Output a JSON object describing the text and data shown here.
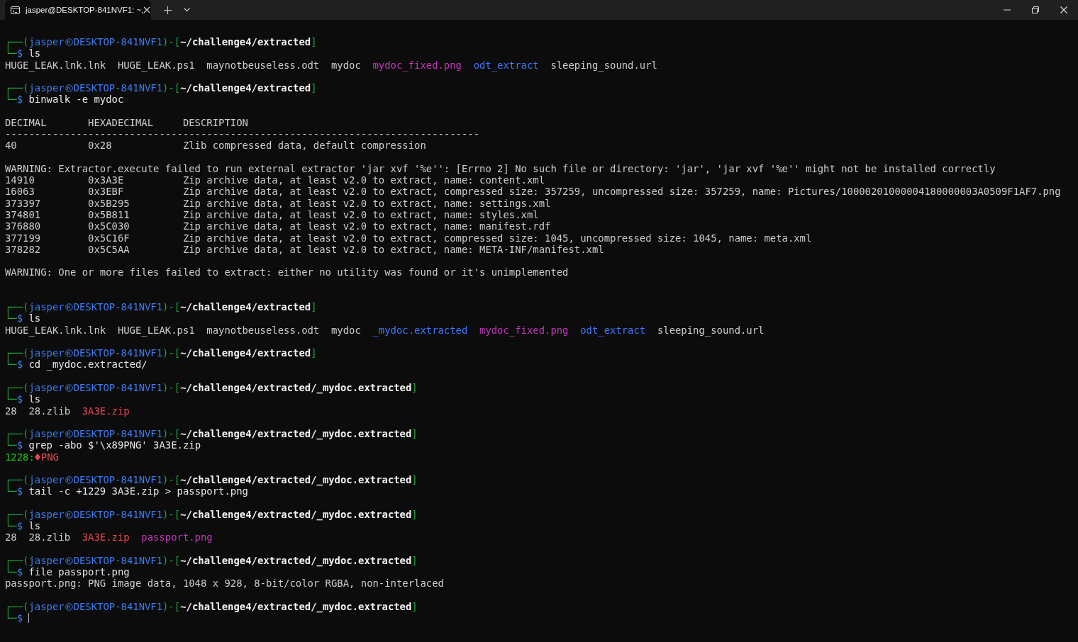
{
  "tabs": [
    {
      "title": "jasper@DESKTOP-841NVF1: ~,",
      "selected": true
    }
  ],
  "terminal": {
    "lines": [
      {
        "kind": "prompt",
        "open": "┌──(",
        "user": "jasper",
        "host": "DESKTOP-841NVF1",
        "mid": ")-[",
        "path": "~/challenge4/extracted",
        "close": "]",
        "corner": "└─",
        "sigil": "$",
        "command": "ls"
      },
      {
        "kind": "listing",
        "items": [
          {
            "text": "HUGE_LEAK.lnk.lnk",
            "color": "#cccccc"
          },
          {
            "text": "HUGE_LEAK.ps1",
            "color": "#cccccc"
          },
          {
            "text": "maynotbeuseless.odt",
            "color": "#cccccc"
          },
          {
            "text": "mydoc",
            "color": "#cccccc"
          },
          {
            "text": "mydoc_fixed.png",
            "color": "#c535bd"
          },
          {
            "text": "odt_extract",
            "color": "#3b78ff"
          },
          {
            "text": "sleeping_sound.url",
            "color": "#cccccc"
          }
        ]
      },
      {
        "kind": "blank"
      },
      {
        "kind": "prompt",
        "open": "┌──(",
        "user": "jasper",
        "host": "DESKTOP-841NVF1",
        "mid": ")-[",
        "path": "~/challenge4/extracted",
        "close": "]",
        "corner": "└─",
        "sigil": "$",
        "command": "binwalk -e mydoc"
      },
      {
        "kind": "blank"
      },
      {
        "kind": "output",
        "segments": [
          {
            "text": "DECIMAL       HEXADECIMAL     DESCRIPTION"
          }
        ]
      },
      {
        "kind": "output",
        "segments": [
          {
            "text": "--------------------------------------------------------------------------------"
          }
        ]
      },
      {
        "kind": "output",
        "segments": [
          {
            "text": "40            0x28            Zlib compressed data, default compression"
          }
        ]
      },
      {
        "kind": "blank"
      },
      {
        "kind": "output",
        "segments": [
          {
            "text": "WARNING: Extractor.execute failed to run external extractor 'jar xvf '%e'': [Errno 2] No such file or directory: 'jar', 'jar xvf '%e'' might not be installed correctly"
          }
        ]
      },
      {
        "kind": "output",
        "segments": [
          {
            "text": "14910         0x3A3E          Zip archive data, at least v2.0 to extract, name: content.xml"
          }
        ]
      },
      {
        "kind": "output",
        "segments": [
          {
            "text": "16063         0x3EBF          Zip archive data, at least v2.0 to extract, compressed size: 357259, uncompressed size: 357259, name: Pictures/10000201000004180000003A0509F1AF7.png"
          }
        ]
      },
      {
        "kind": "output",
        "segments": [
          {
            "text": "373397        0x5B295         Zip archive data, at least v2.0 to extract, name: settings.xml"
          }
        ]
      },
      {
        "kind": "output",
        "segments": [
          {
            "text": "374801        0x5B811         Zip archive data, at least v2.0 to extract, name: styles.xml"
          }
        ]
      },
      {
        "kind": "output",
        "segments": [
          {
            "text": "376880        0x5C030         Zip archive data, at least v2.0 to extract, name: manifest.rdf"
          }
        ]
      },
      {
        "kind": "output",
        "segments": [
          {
            "text": "377199        0x5C16F         Zip archive data, at least v2.0 to extract, compressed size: 1045, uncompressed size: 1045, name: meta.xml"
          }
        ]
      },
      {
        "kind": "output",
        "segments": [
          {
            "text": "378282        0x5C5AA         Zip archive data, at least v2.0 to extract, name: META-INF/manifest.xml"
          }
        ]
      },
      {
        "kind": "blank"
      },
      {
        "kind": "output",
        "segments": [
          {
            "text": "WARNING: One or more files failed to extract: either no utility was found or it's unimplemented"
          }
        ]
      },
      {
        "kind": "blank"
      },
      {
        "kind": "blank"
      },
      {
        "kind": "prompt",
        "open": "┌──(",
        "user": "jasper",
        "host": "DESKTOP-841NVF1",
        "mid": ")-[",
        "path": "~/challenge4/extracted",
        "close": "]",
        "corner": "└─",
        "sigil": "$",
        "command": "ls"
      },
      {
        "kind": "listing",
        "items": [
          {
            "text": "HUGE_LEAK.lnk.lnk",
            "color": "#cccccc"
          },
          {
            "text": "HUGE_LEAK.ps1",
            "color": "#cccccc"
          },
          {
            "text": "maynotbeuseless.odt",
            "color": "#cccccc"
          },
          {
            "text": "mydoc",
            "color": "#cccccc"
          },
          {
            "text": "_mydoc.extracted",
            "color": "#3b78ff"
          },
          {
            "text": "mydoc_fixed.png",
            "color": "#c535bd"
          },
          {
            "text": "odt_extract",
            "color": "#3b78ff"
          },
          {
            "text": "sleeping_sound.url",
            "color": "#cccccc"
          }
        ]
      },
      {
        "kind": "blank"
      },
      {
        "kind": "prompt",
        "open": "┌──(",
        "user": "jasper",
        "host": "DESKTOP-841NVF1",
        "mid": ")-[",
        "path": "~/challenge4/extracted",
        "close": "]",
        "corner": "└─",
        "sigil": "$",
        "command": "cd _mydoc.extracted/"
      },
      {
        "kind": "blank"
      },
      {
        "kind": "prompt",
        "open": "┌──(",
        "user": "jasper",
        "host": "DESKTOP-841NVF1",
        "mid": ")-[",
        "path": "~/challenge4/extracted/_mydoc.extracted",
        "close": "]",
        "corner": "└─",
        "sigil": "$",
        "command": "ls"
      },
      {
        "kind": "listing",
        "items": [
          {
            "text": "28",
            "color": "#cccccc"
          },
          {
            "text": "28.zlib",
            "color": "#cccccc"
          },
          {
            "text": "3A3E.zip",
            "color": "#e74856"
          }
        ]
      },
      {
        "kind": "blank"
      },
      {
        "kind": "prompt",
        "open": "┌──(",
        "user": "jasper",
        "host": "DESKTOP-841NVF1",
        "mid": ")-[",
        "path": "~/challenge4/extracted/_mydoc.extracted",
        "close": "]",
        "corner": "└─",
        "sigil": "$",
        "command": "grep -abo $'\\x89PNG' 3A3E.zip"
      },
      {
        "kind": "output",
        "segments": [
          {
            "text": "1228:",
            "color": "#16c60c"
          },
          {
            "kind": "glyph",
            "color": "#e74856"
          },
          {
            "text": "PNG",
            "color": "#e74856"
          }
        ]
      },
      {
        "kind": "blank"
      },
      {
        "kind": "prompt",
        "open": "┌──(",
        "user": "jasper",
        "host": "DESKTOP-841NVF1",
        "mid": ")-[",
        "path": "~/challenge4/extracted/_mydoc.extracted",
        "close": "]",
        "corner": "└─",
        "sigil": "$",
        "command": "tail -c +1229 3A3E.zip > passport.png"
      },
      {
        "kind": "blank"
      },
      {
        "kind": "prompt",
        "open": "┌──(",
        "user": "jasper",
        "host": "DESKTOP-841NVF1",
        "mid": ")-[",
        "path": "~/challenge4/extracted/_mydoc.extracted",
        "close": "]",
        "corner": "└─",
        "sigil": "$",
        "command": "ls"
      },
      {
        "kind": "listing",
        "items": [
          {
            "text": "28",
            "color": "#cccccc"
          },
          {
            "text": "28.zlib",
            "color": "#cccccc"
          },
          {
            "text": "3A3E.zip",
            "color": "#e74856"
          },
          {
            "text": "passport.png",
            "color": "#c535bd"
          }
        ]
      },
      {
        "kind": "blank"
      },
      {
        "kind": "prompt",
        "open": "┌──(",
        "user": "jasper",
        "host": "DESKTOP-841NVF1",
        "mid": ")-[",
        "path": "~/challenge4/extracted/_mydoc.extracted",
        "close": "]",
        "corner": "└─",
        "sigil": "$",
        "command": "file passport.png"
      },
      {
        "kind": "output",
        "segments": [
          {
            "text": "passport.png: PNG image data, 1048 x 928, 8-bit/color RGBA, non-interlaced"
          }
        ]
      },
      {
        "kind": "blank"
      },
      {
        "kind": "prompt",
        "open": "┌──(",
        "user": "jasper",
        "host": "DESKTOP-841NVF1",
        "mid": ")-[",
        "path": "~/challenge4/extracted/_mydoc.extracted",
        "close": "]",
        "corner": "└─",
        "sigil": "$",
        "cursor": true
      }
    ]
  }
}
